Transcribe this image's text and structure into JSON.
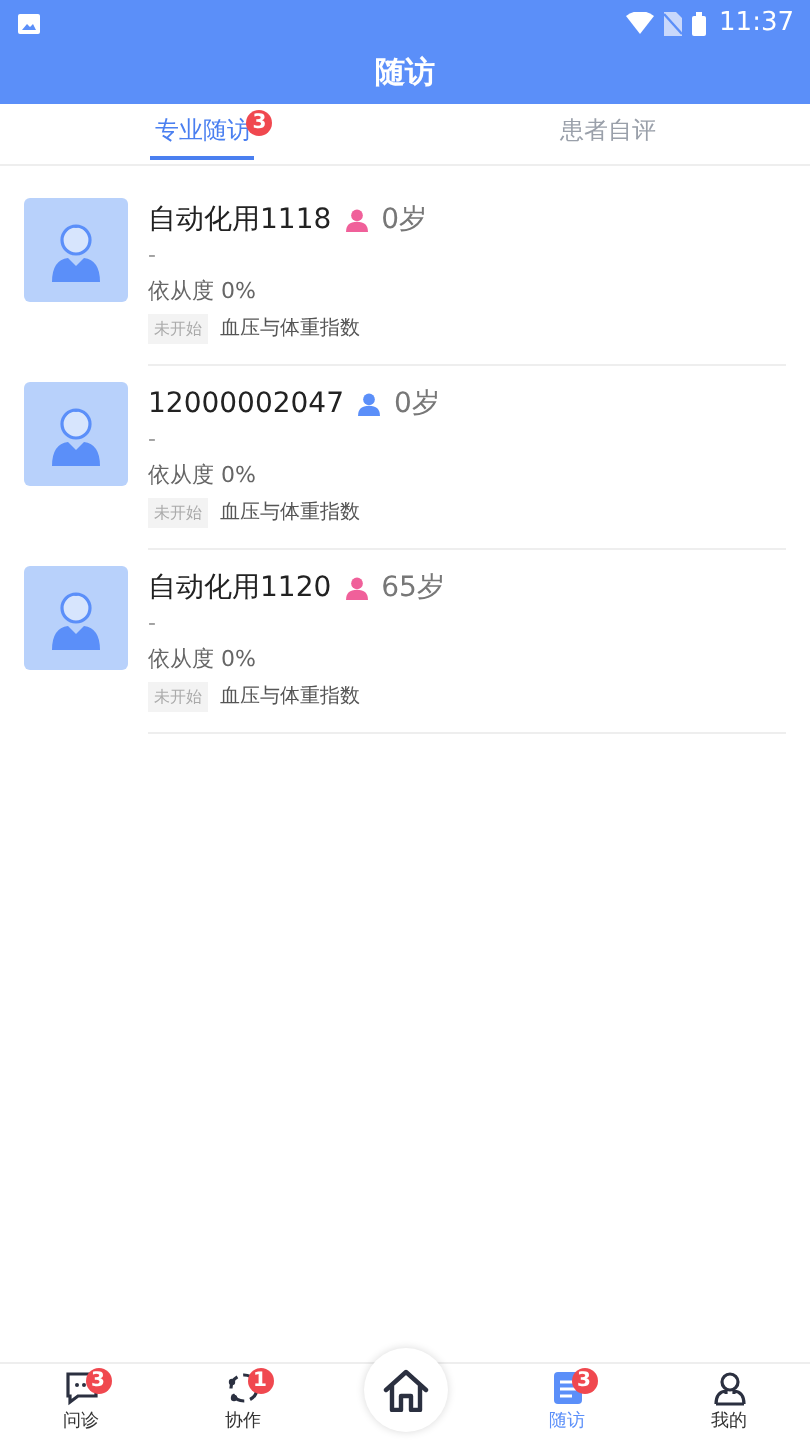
{
  "status_bar": {
    "time": "11:37"
  },
  "header": {
    "title": "随访"
  },
  "tabs": [
    {
      "label": "专业随访",
      "badge": "3",
      "selected": true
    },
    {
      "label": "患者自评",
      "selected": false
    }
  ],
  "patients": [
    {
      "name": "自动化用1118",
      "color": "#f0609a",
      "age": "0岁",
      "note": "-",
      "compliance": "依从度 0%",
      "status": "未开始",
      "plan": "血压与体重指数"
    },
    {
      "name": "12000002047",
      "color": "#5b8ff9",
      "age": "0岁",
      "note": "-",
      "compliance": "依从度 0%",
      "status": "未开始",
      "plan": "血压与体重指数"
    },
    {
      "name": "自动化用1120",
      "color": "#f0609a",
      "age": "65岁",
      "note": "-",
      "compliance": "依从度 0%",
      "status": "未开始",
      "plan": "血压与体重指数"
    }
  ],
  "nav": [
    {
      "kind": "chat",
      "label": "问诊",
      "badge": "3",
      "selected": false
    },
    {
      "kind": "team",
      "label": "协作",
      "badge": "1",
      "selected": false
    },
    {
      "kind": "home",
      "selected": false
    },
    {
      "kind": "followup",
      "label": "随访",
      "badge": "3",
      "selected": true
    },
    {
      "kind": "user",
      "label": "我的",
      "selected": false
    }
  ]
}
